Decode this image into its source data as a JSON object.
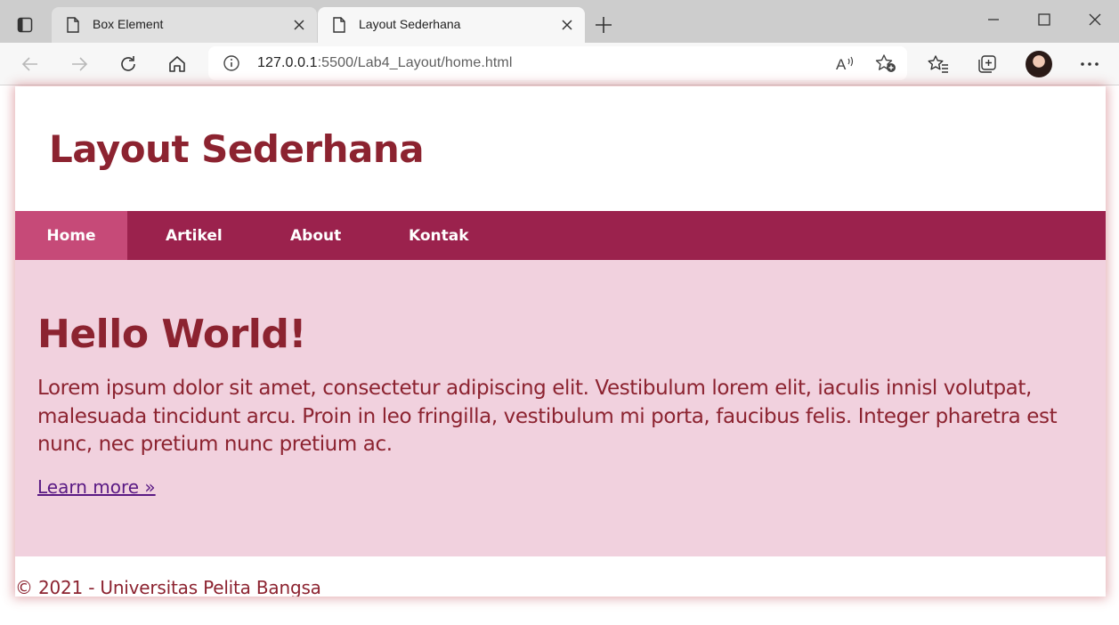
{
  "browser": {
    "tabs": [
      {
        "title": "Box Element",
        "active": false
      },
      {
        "title": "Layout Sederhana",
        "active": true
      }
    ],
    "url_host": "127.0.0.1",
    "url_rest": ":5500/Lab4_Layout/home.html"
  },
  "header": {
    "title": "Layout Sederhana"
  },
  "nav": {
    "items": [
      {
        "label": "Home",
        "active": true
      },
      {
        "label": "Artikel",
        "active": false
      },
      {
        "label": "About",
        "active": false
      },
      {
        "label": "Kontak",
        "active": false
      }
    ]
  },
  "hero": {
    "title": "Hello World!",
    "text": "Lorem ipsum dolor sit amet, consectetur adipiscing elit. Vestibulum lorem elit, iaculis innisl volutpat, malesuada tincidunt arcu. Proin in leo fringilla, vestibulum mi porta, faucibus felis. Integer pharetra est nunc, nec pretium nunc pretium ac.",
    "link": "Learn more »"
  },
  "footer": {
    "text": "© 2021 - Universitas Pelita Bangsa"
  },
  "colors": {
    "accent": "#8c2330",
    "nav_bg": "#9b224d",
    "nav_active": "#c64a78",
    "hero_bg": "#f1d1de"
  }
}
